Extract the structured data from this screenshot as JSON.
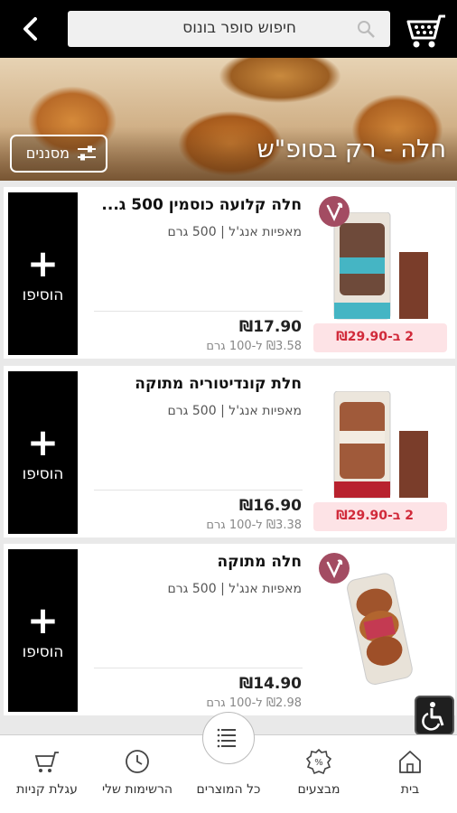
{
  "header": {
    "search_placeholder": "חיפוש סופר בונוס",
    "back_icon": "chevron-left-icon",
    "cart_icon": "shopping-cart-icon"
  },
  "banner": {
    "title": "חלה - רק בסופ\"ש",
    "filter_label": "מסננים"
  },
  "products": [
    {
      "title": "חלה קלועה כוסמין 500 ג...",
      "brand": "מאפיות אנג'ל",
      "size": "500 גרם",
      "price": "₪17.90",
      "unit_price": "₪3.58 ל-100 גרם",
      "deal": "2 ב-₪29.90",
      "add_label": "הוסיפו",
      "vegan": true
    },
    {
      "title": "חלת קונדיטוריה מתוקה",
      "brand": "מאפיות אנג'ל",
      "size": "500 גרם",
      "price": "₪16.90",
      "unit_price": "₪3.38 ל-100 גרם",
      "deal": "2 ב-₪29.90",
      "add_label": "הוסיפו",
      "vegan": false
    },
    {
      "title": "חלה מתוקה",
      "brand": "מאפיות אנג'ל",
      "size": "500 גרם",
      "price": "₪14.90",
      "unit_price": "₪2.98 ל-100 גרם",
      "deal": "",
      "add_label": "הוסיפו",
      "vegan": true
    }
  ],
  "bottom_nav": [
    {
      "label": "עגלת קניות",
      "icon": "shopping-cart-icon"
    },
    {
      "label": "הרשימות שלי",
      "icon": "clock-icon"
    },
    {
      "label": "כל המוצרים",
      "icon": "list-icon"
    },
    {
      "label": "מבצעים",
      "icon": "percent-badge-icon"
    },
    {
      "label": "בית",
      "icon": "home-icon"
    }
  ],
  "colors": {
    "header_bg": "#000000",
    "deal_bg": "#fde3e6",
    "deal_text": "#d12a3a",
    "vegan_badge": "#a34c62"
  }
}
